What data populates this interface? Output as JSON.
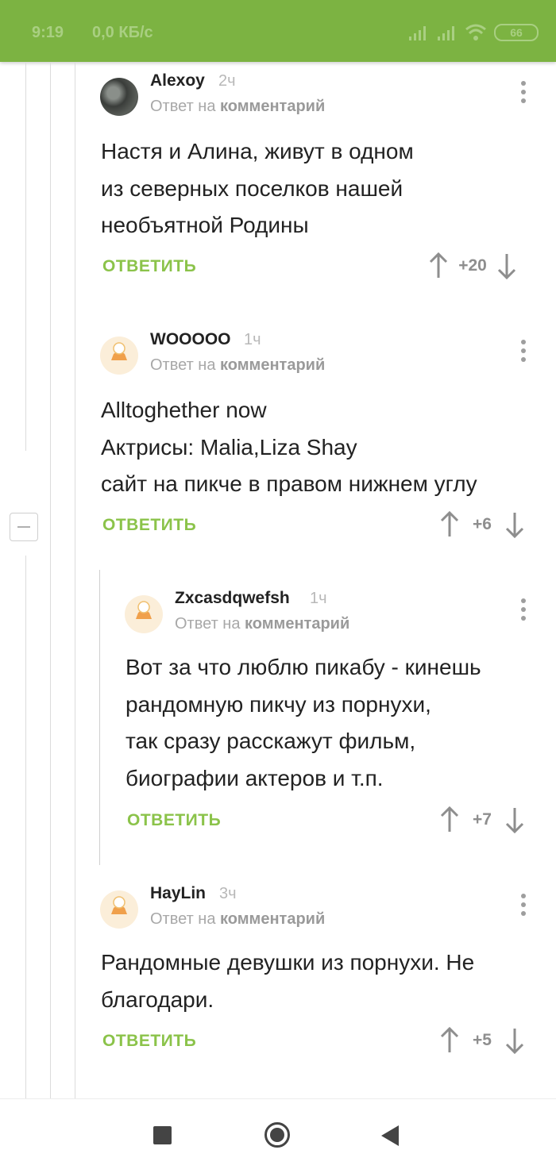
{
  "status_bar": {
    "time": "9:19",
    "net_speed": "0,0 КБ/с",
    "battery": "66"
  },
  "comments": [
    {
      "username": "Alexoy",
      "time": "2ч",
      "reply_prefix": "Ответ на",
      "reply_target": "комментарий",
      "lines": [
        "Настя и Алина, живут в одном",
        "из северных поселков нашей",
        "необъятной Родины"
      ],
      "reply_label": "ОТВЕТИТЬ",
      "score": "+20",
      "avatar": "photo-avatar"
    },
    {
      "username": "WOOOOO",
      "time": "1ч",
      "reply_prefix": "Ответ на",
      "reply_target": "комментарий",
      "lines": [
        "Alltoghether now",
        "Актрисы: Malia,Liza Shay",
        "сайт на пикче в правом нижнем углу"
      ],
      "reply_label": "ОТВЕТИТЬ",
      "score": "+6",
      "avatar": "default-avatar"
    },
    {
      "username": "Zxcasdqwefsh",
      "time": "1ч",
      "reply_prefix": "Ответ на",
      "reply_target": "комментарий",
      "lines": [
        "Вот за что люблю пикабу - кинешь",
        "рандомную пикчу из порнухи,",
        "так сразу расскажут фильм,",
        "биографии актеров и т.п."
      ],
      "reply_label": "ОТВЕТИТЬ",
      "score": "+7",
      "avatar": "default-avatar"
    },
    {
      "username": "HayLin",
      "time": "3ч",
      "reply_prefix": "Ответ на",
      "reply_target": "комментарий",
      "lines": [
        "Рандомные девушки из порнухи. Не",
        "благодари."
      ],
      "reply_label": "ОТВЕТИТЬ",
      "score": "+5",
      "avatar": "default-avatar"
    }
  ],
  "colors": {
    "status_bar": "#7cb342",
    "reply_button": "#8bc34a",
    "text": "#222222",
    "muted": "#a8a8a8"
  },
  "icons": [
    "signal-icon",
    "wifi-icon",
    "battery-icon",
    "more-vert-icon",
    "arrow-up-icon",
    "arrow-down-icon",
    "collapse-icon",
    "nav-recents-icon",
    "nav-home-icon",
    "nav-back-icon"
  ]
}
